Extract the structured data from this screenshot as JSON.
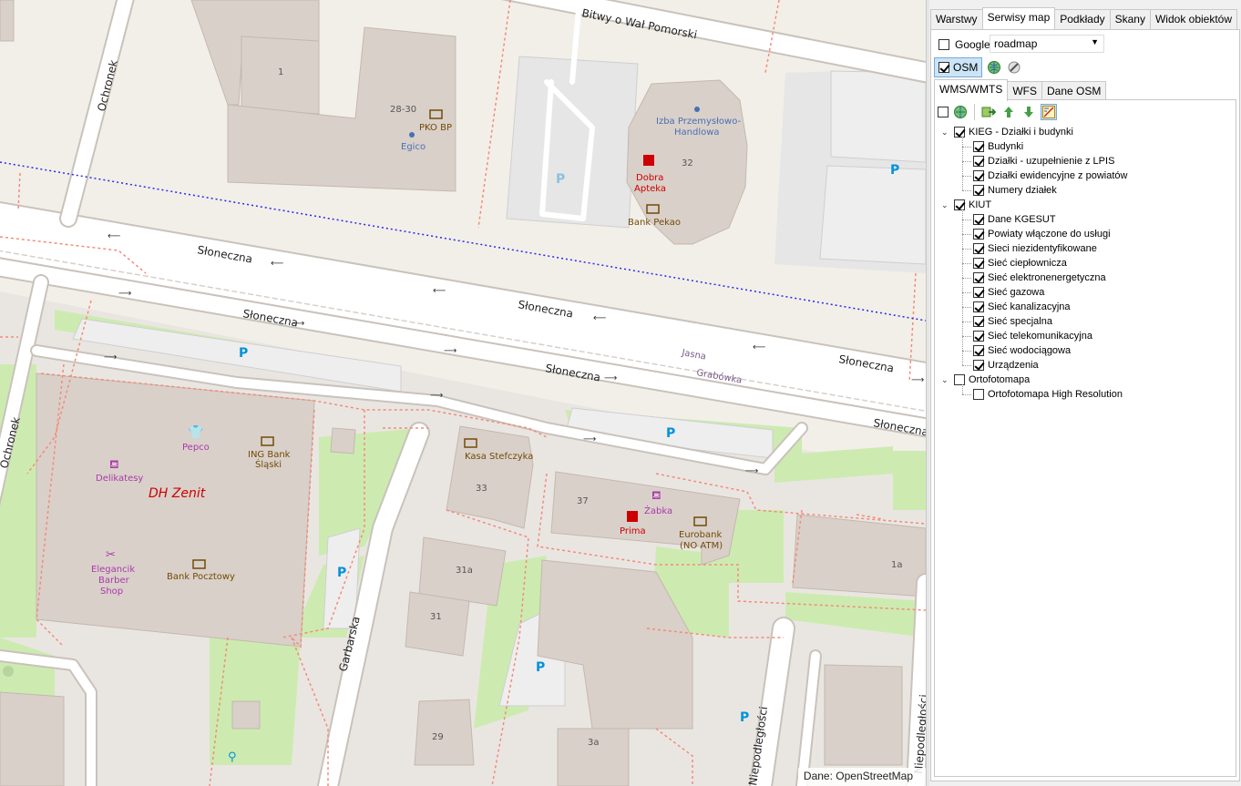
{
  "map": {
    "attribution": "Dane: OpenStreetMap",
    "streets": {
      "bitwy": "Bitwy o Wał Pomorski",
      "ochronek_top": "Ochronek",
      "ochronek_left": "Ochronek",
      "sloneczna": "Słoneczna",
      "jasna": "Jasna",
      "grabowka": "Grabówka",
      "garbarska": "Garbarska",
      "niepodleglosci": "Niepodległości"
    },
    "house_numbers": [
      "1",
      "28-30",
      "32",
      "33",
      "37",
      "31a",
      "31",
      "29",
      "3a",
      "1a"
    ],
    "pois": {
      "pko": "PKO BP",
      "egico": "Egico",
      "izba": "Izba Przemysłowo-",
      "izba2": "Handlowa",
      "dobra": "Dobra",
      "apteka": "Apteka",
      "pekao": "Bank Pekao",
      "pepco": "Pepco",
      "ing": "ING Bank",
      "ing2": "Śląski",
      "delikatesy": "Delikatesy",
      "dh_zenit": "DH Zenit",
      "elegancik": "Elegancik",
      "barber": "Barber",
      "shop": "Shop",
      "pocztowy": "Bank Pocztowy",
      "kasa": "Kasa Stefczyka",
      "zabka": "Żabka",
      "prima": "Prima",
      "eurobank": "Eurobank",
      "eurobank2": "(NO ATM)"
    },
    "parking_label": "P"
  },
  "panel": {
    "main_tabs": [
      {
        "label": "Warstwy",
        "active": false
      },
      {
        "label": "Serwisy map",
        "active": true
      },
      {
        "label": "Podkłady",
        "active": false
      },
      {
        "label": "Skany",
        "active": false
      },
      {
        "label": "Widok obiektów",
        "active": false
      }
    ],
    "google": {
      "label": "Google",
      "checked": false,
      "select_value": "roadmap"
    },
    "osm": {
      "label": "OSM",
      "checked": true
    },
    "sub_tabs": [
      {
        "label": "WMS/WMTS",
        "active": true
      },
      {
        "label": "WFS",
        "active": false
      },
      {
        "label": "Dane OSM",
        "active": false
      }
    ],
    "tree": [
      {
        "label": "KIEG - Działki i budynki",
        "checked": true,
        "level": 0,
        "expanded": true
      },
      {
        "label": "Budynki",
        "checked": true,
        "level": 1
      },
      {
        "label": "Działki - uzupełnienie z LPIS",
        "checked": true,
        "level": 1
      },
      {
        "label": "Działki ewidencyjne z powiatów",
        "checked": true,
        "level": 1
      },
      {
        "label": "Numery działek",
        "checked": true,
        "level": 1
      },
      {
        "label": "KIUT",
        "checked": true,
        "level": 0,
        "expanded": true
      },
      {
        "label": "Dane KGESUT",
        "checked": true,
        "level": 1
      },
      {
        "label": "Powiaty włączone do usługi",
        "checked": true,
        "level": 1
      },
      {
        "label": "Sieci niezidentyfikowane",
        "checked": true,
        "level": 1
      },
      {
        "label": "Sieć ciepłownicza",
        "checked": true,
        "level": 1
      },
      {
        "label": "Sieć elektronenergetyczna",
        "checked": true,
        "level": 1
      },
      {
        "label": "Sieć gazowa",
        "checked": true,
        "level": 1
      },
      {
        "label": "Sieć kanalizacyjna",
        "checked": true,
        "level": 1
      },
      {
        "label": "Sieć specjalna",
        "checked": true,
        "level": 1
      },
      {
        "label": "Sieć telekomunikacyjna",
        "checked": true,
        "level": 1
      },
      {
        "label": "Sieć wodociągowa",
        "checked": true,
        "level": 1
      },
      {
        "label": "Urządzenia",
        "checked": true,
        "level": 1
      },
      {
        "label": "Ortofotomapa",
        "checked": false,
        "level": 0,
        "expanded": true
      },
      {
        "label": "Ortofotomapa High Resolution",
        "checked": false,
        "level": 1
      }
    ]
  }
}
